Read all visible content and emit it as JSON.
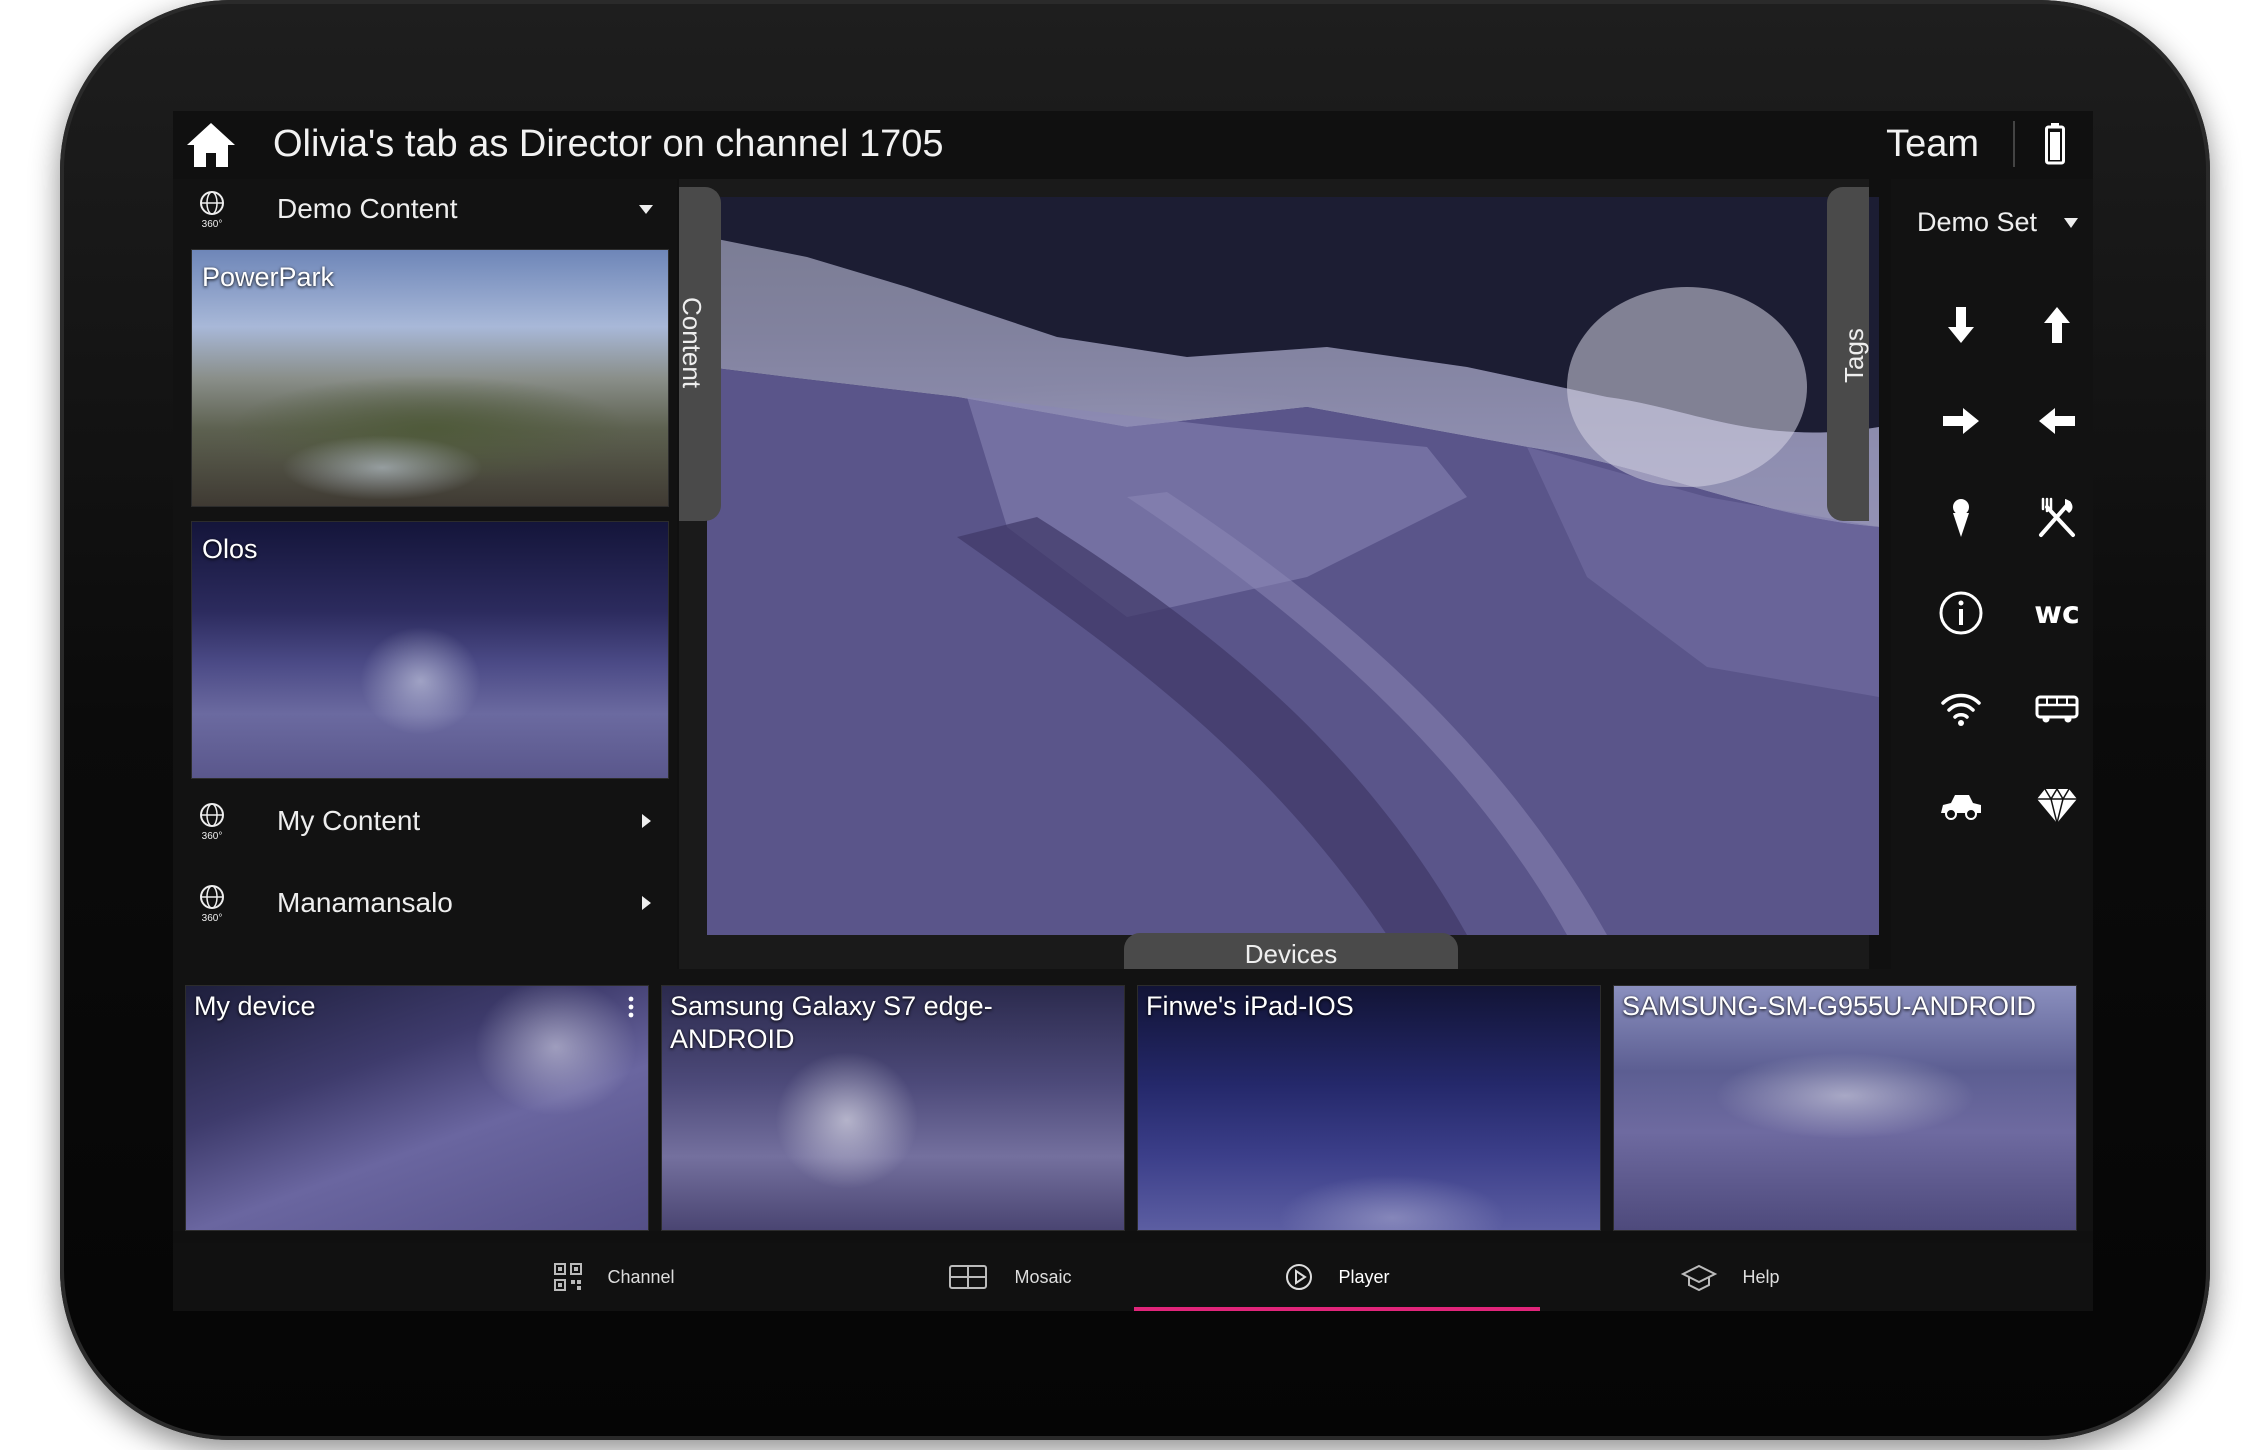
{
  "header": {
    "title": "Olivia's tab as Director on channel 1705",
    "team_label": "Team"
  },
  "left_panel": {
    "groups": [
      {
        "label": "Demo Content",
        "globe_text": "360°",
        "expanded": true
      },
      {
        "label": "My Content",
        "globe_text": "360°",
        "expanded": false
      },
      {
        "label": "Manamansalo",
        "globe_text": "360°",
        "expanded": false
      }
    ],
    "thumbnails": [
      {
        "label": "PowerPark"
      },
      {
        "label": "Olos"
      }
    ]
  },
  "center": {
    "content_tab": "Content",
    "tags_tab": "Tags",
    "devices_tab": "Devices"
  },
  "right_panel": {
    "set_label": "Demo Set",
    "tag_icons": [
      "arrow-down-icon",
      "arrow-up-icon",
      "arrow-right-icon",
      "arrow-left-icon",
      "ice-cream-icon",
      "fork-knife-icon",
      "info-icon",
      "wc-icon",
      "wifi-icon",
      "bus-icon",
      "car-icon",
      "diamond-icon"
    ],
    "wc_text": "wc"
  },
  "devices": [
    {
      "label": "My device"
    },
    {
      "label": "Samsung Galaxy S7 edge-ANDROID"
    },
    {
      "label": "Finwe's iPad-IOS"
    },
    {
      "label": "SAMSUNG-SM-G955U-ANDROID"
    }
  ],
  "nav": {
    "items": [
      {
        "label": "Channel",
        "icon": "qr-code-icon"
      },
      {
        "label": "Mosaic",
        "icon": "mosaic-icon"
      },
      {
        "label": "Player",
        "icon": "play-icon",
        "active": true
      },
      {
        "label": "Help",
        "icon": "help-icon"
      }
    ],
    "accent_color": "#e0257a"
  }
}
